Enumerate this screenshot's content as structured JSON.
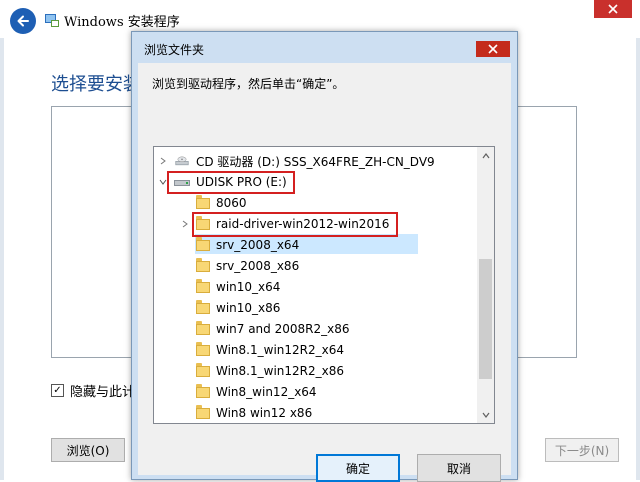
{
  "setup": {
    "title": "Windows 安装程序",
    "heading": "选择要安装",
    "hide_checkbox_label": "隐藏与此计",
    "browse_button": "浏览(O)",
    "next_button": "下一步(N)"
  },
  "dialog": {
    "title": "浏览文件夹",
    "message": "浏览到驱动程序，然后单击“确定”。",
    "ok_button": "确定",
    "cancel_button": "取消"
  },
  "tree": {
    "cd_drive": "CD 驱动器 (D:) SSS_X64FRE_ZH-CN_DV9",
    "usb_drive": "UDISK PRO (E:)",
    "folders": [
      "8060",
      "raid-driver-win2012-win2016",
      "srv_2008_x64",
      "srv_2008_x86",
      "win10_x64",
      "win10_x86",
      "win7 and 2008R2_x86",
      "Win8.1_win12R2_x64",
      "Win8.1_win12R2_x86",
      "Win8_win12_x64",
      "Win8 win12 x86"
    ],
    "selected_folder": "raid-driver-win2012-win2016"
  },
  "colors": {
    "accent_blue": "#1e5fb4",
    "dialog_frame": "#cddff2",
    "highlight_red": "#d42020",
    "selection": "#cce8ff",
    "folder_yellow": "#f8d775"
  }
}
